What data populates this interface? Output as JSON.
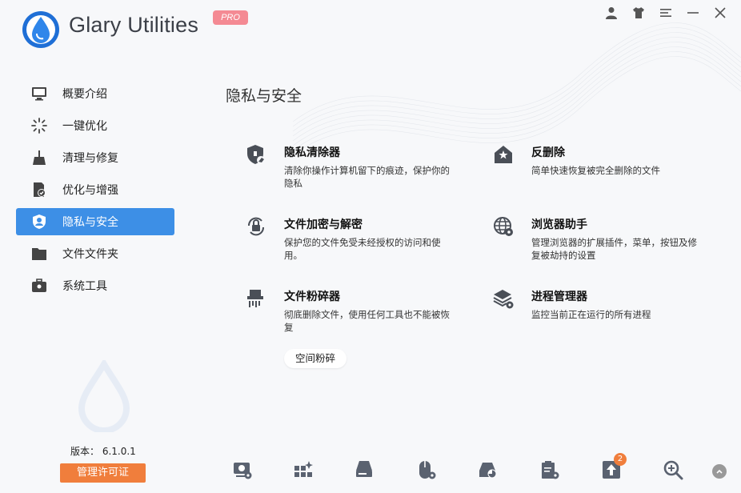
{
  "app": {
    "title": "Glary Utilities",
    "badge": "PRO",
    "accent": "#3d8fe6",
    "license_color": "#f07e3c"
  },
  "sidebar": {
    "items": [
      {
        "label": "概要介绍",
        "icon": "monitor-icon"
      },
      {
        "label": "一键优化",
        "icon": "sparkle-icon"
      },
      {
        "label": "清理与修复",
        "icon": "broom-icon"
      },
      {
        "label": "优化与增强",
        "icon": "document-check-icon"
      },
      {
        "label": "隐私与安全",
        "icon": "user-shield-icon",
        "active": true
      },
      {
        "label": "文件文件夹",
        "icon": "folder-icon"
      },
      {
        "label": "系统工具",
        "icon": "toolbox-icon"
      }
    ],
    "version": "版本： 6.1.0.1",
    "license_button": "管理许可证"
  },
  "main": {
    "title": "隐私与安全",
    "features": [
      {
        "title": "隐私清除器",
        "desc": "清除你操作计算机留下的痕迹，保护你的隐私",
        "icon": "shield-eraser-icon"
      },
      {
        "title": "反删除",
        "desc": "简单快速恢复被完全删除的文件",
        "icon": "house-restore-icon"
      },
      {
        "title": "文件加密与解密",
        "desc": "保护您的文件免受未经授权的访问和使用。",
        "icon": "lock-sync-icon"
      },
      {
        "title": "浏览器助手",
        "desc": "管理浏览器的扩展插件，菜单，按钮及修复被劫持的设置",
        "icon": "globe-gear-icon"
      },
      {
        "title": "文件粉碎器",
        "desc": "彻底删除文件，使用任何工具也不能被恢复",
        "icon": "shredder-icon"
      },
      {
        "title": "进程管理器",
        "desc": "监控当前正在运行的所有进程",
        "icon": "layers-gear-icon"
      }
    ],
    "sub_button": "空间粉碎"
  },
  "toolbar": {
    "items": [
      {
        "icon": "disk-cleanup-icon"
      },
      {
        "icon": "apps-sparkle-icon"
      },
      {
        "icon": "disk-repair-icon"
      },
      {
        "icon": "mouse-gear-icon"
      },
      {
        "icon": "disk-analysis-icon"
      },
      {
        "icon": "clipboard-gear-icon"
      },
      {
        "icon": "upgrade-arrow-icon",
        "badge": "2"
      },
      {
        "icon": "search-zoom-icon"
      }
    ]
  }
}
